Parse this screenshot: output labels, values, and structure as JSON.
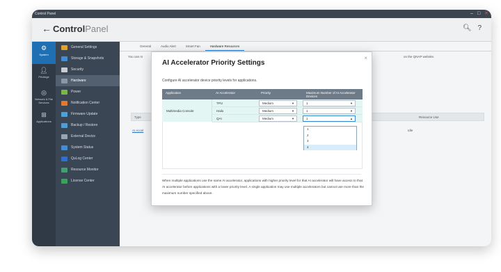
{
  "window": {
    "title": "Control Panel"
  },
  "header": {
    "brand_bold": "Control",
    "brand_light": "Panel"
  },
  "leftnav": [
    {
      "label": "System",
      "icon": "gear-icon"
    },
    {
      "label": "Privilege",
      "icon": "user-icon"
    },
    {
      "label": "Network & File Services",
      "icon": "network-icon"
    },
    {
      "label": "Applications",
      "icon": "apps-icon"
    }
  ],
  "menu": [
    {
      "label": "General Settings",
      "color": "#e0a130"
    },
    {
      "label": "Storage & Snapshots",
      "color": "#3f8ed8"
    },
    {
      "label": "Security",
      "color": "#c9ccd0"
    },
    {
      "label": "Hardware",
      "color": "#8a97a6"
    },
    {
      "label": "Power",
      "color": "#7ab648"
    },
    {
      "label": "Notification Center",
      "color": "#e07a30"
    },
    {
      "label": "Firmware Update",
      "color": "#4aa0e0"
    },
    {
      "label": "Backup / Restore",
      "color": "#4c9ed8"
    },
    {
      "label": "External Device",
      "color": "#9aa4ae"
    },
    {
      "label": "System Status",
      "color": "#3f8ed8"
    },
    {
      "label": "QuLog Center",
      "color": "#2f6fd0"
    },
    {
      "label": "Resource Monitor",
      "color": "#3fa070"
    },
    {
      "label": "License Center",
      "color": "#3aa35a"
    }
  ],
  "tabs": [
    "General",
    "Audio Alert",
    "Smart Fan",
    "Hardware Resources"
  ],
  "background": {
    "intro": "You can m",
    "intro_right": "on the QNAP website.",
    "col_type": "Type",
    "col_resource": "Resource Use",
    "row_link": "AI Accel",
    "row_value": "Idle"
  },
  "modal": {
    "title": "AI Accelerator Priority Settings",
    "close": "×",
    "description": "Configure AI accelerator device priority levels for applications.",
    "columns": [
      "Application",
      "AI Accelerator",
      "Priority",
      "Maximum Number of AI Accelerator Devices"
    ],
    "application": "Multimedia Console",
    "rows": [
      {
        "accelerator": "TPU",
        "priority": "Medium",
        "max": "1"
      },
      {
        "accelerator": "Hailo",
        "priority": "Medium",
        "max": "1"
      },
      {
        "accelerator": "QAI",
        "priority": "Medium",
        "max": "1"
      }
    ],
    "dropdown_options": [
      "1",
      "2",
      "3",
      "4"
    ],
    "footer": "When multiple applications use the same AI accelerator, applications with higher priority level for that AI accelerator will have access to that AI accelerator before applications with a lower priority level. A single application may use multiple accelerators but cannot use more than the maximum number specified above."
  }
}
